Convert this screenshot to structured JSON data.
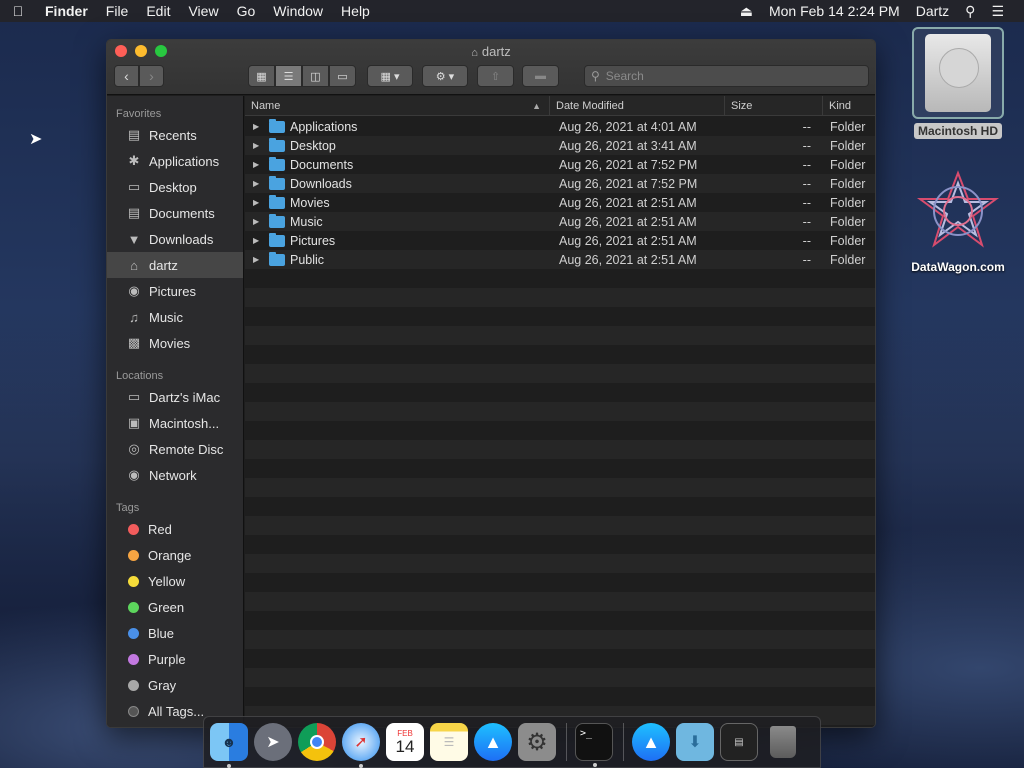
{
  "menubar": {
    "app_name": "Finder",
    "items": [
      "File",
      "Edit",
      "View",
      "Go",
      "Window",
      "Help"
    ],
    "datetime": "Mon Feb 14  2:24 PM",
    "user": "Dartz"
  },
  "window": {
    "title": "dartz",
    "search_placeholder": "Search"
  },
  "sidebar": {
    "favorites_header": "Favorites",
    "favorites": [
      "Recents",
      "Applications",
      "Desktop",
      "Documents",
      "Downloads",
      "dartz",
      "Pictures",
      "Music",
      "Movies"
    ],
    "locations_header": "Locations",
    "locations": [
      "Dartz's iMac",
      "Macintosh...",
      "Remote Disc",
      "Network"
    ],
    "tags_header": "Tags",
    "tags": [
      "Red",
      "Orange",
      "Yellow",
      "Green",
      "Blue",
      "Purple",
      "Gray",
      "All Tags..."
    ],
    "tag_colors": [
      "#f25c5c",
      "#f5a442",
      "#f5dc3a",
      "#5dd55d",
      "#4a90e8",
      "#c278e0",
      "#a8a8a8",
      "#555555"
    ]
  },
  "columns": {
    "name": "Name",
    "date": "Date Modified",
    "size": "Size",
    "kind": "Kind"
  },
  "files": [
    {
      "name": "Applications",
      "date": "Aug 26, 2021 at 4:01 AM",
      "size": "--",
      "kind": "Folder"
    },
    {
      "name": "Desktop",
      "date": "Aug 26, 2021 at 3:41 AM",
      "size": "--",
      "kind": "Folder"
    },
    {
      "name": "Documents",
      "date": "Aug 26, 2021 at 7:52 PM",
      "size": "--",
      "kind": "Folder"
    },
    {
      "name": "Downloads",
      "date": "Aug 26, 2021 at 7:52 PM",
      "size": "--",
      "kind": "Folder"
    },
    {
      "name": "Movies",
      "date": "Aug 26, 2021 at 2:51 AM",
      "size": "--",
      "kind": "Folder"
    },
    {
      "name": "Music",
      "date": "Aug 26, 2021 at 2:51 AM",
      "size": "--",
      "kind": "Folder"
    },
    {
      "name": "Pictures",
      "date": "Aug 26, 2021 at 2:51 AM",
      "size": "--",
      "kind": "Folder"
    },
    {
      "name": "Public",
      "date": "Aug 26, 2021 at 2:51 AM",
      "size": "--",
      "kind": "Folder"
    }
  ],
  "desktop": {
    "hd_label": "Macintosh HD",
    "dw_label": "DataWagon.com"
  },
  "dock": {
    "calendar_month": "FEB",
    "calendar_day": "14"
  }
}
